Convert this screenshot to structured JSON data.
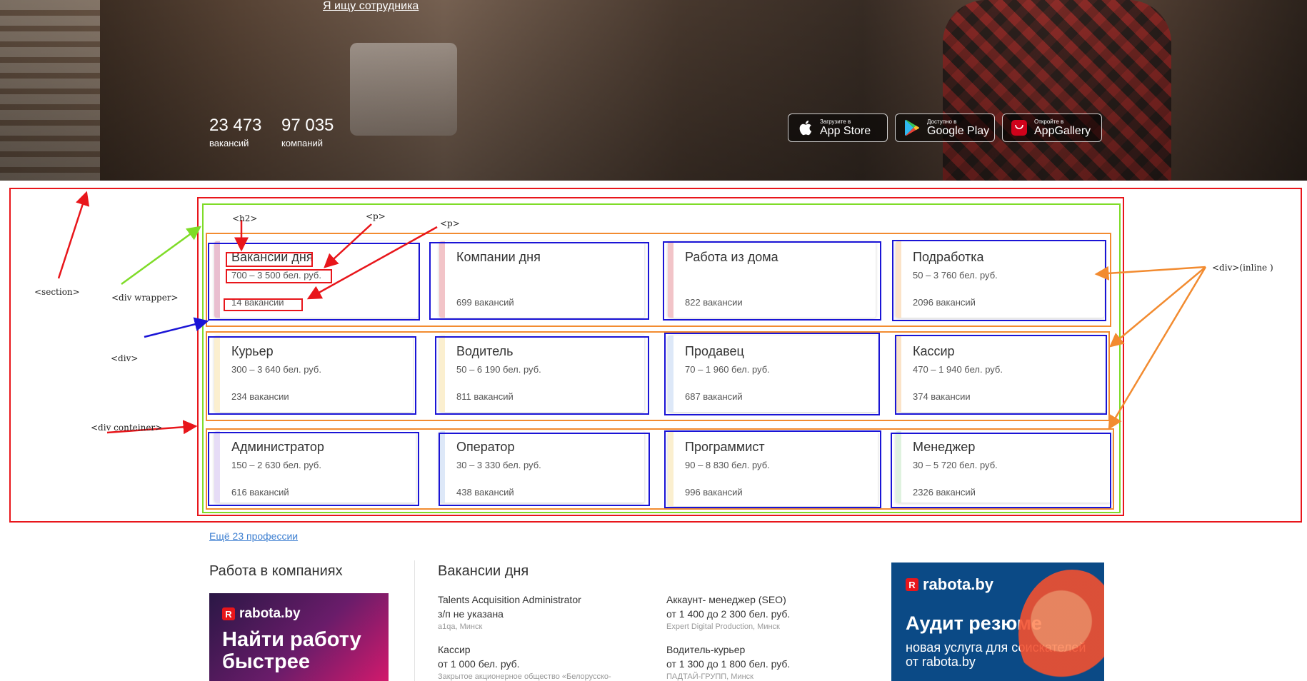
{
  "hero": {
    "employer_link": "Я ищу сотрудника",
    "stats": [
      {
        "value": "23 473",
        "label": "вакансий"
      },
      {
        "value": "97 035",
        "label": "компаний"
      }
    ],
    "stores": [
      {
        "small": "Загрузите в",
        "big": "App Store",
        "icon": "apple-icon"
      },
      {
        "small": "Доступно в",
        "big": "Google Play",
        "icon": "google-play-icon"
      },
      {
        "small": "Откройте в",
        "big": "AppGallery",
        "icon": "huawei-appgallery-icon"
      }
    ]
  },
  "annotations": {
    "section": "<section>",
    "wrapper": "<div wrapper>",
    "div": "<div>",
    "container": "<div conteiner>",
    "h2": "<h2>",
    "p1": "<p>",
    "p2": "<p>",
    "inline": "<div>(inline )",
    "colors": {
      "section": "#e8161b",
      "wrapper": "#7fdc28",
      "row": "#f28b30",
      "card": "#1a14d6"
    }
  },
  "cards": [
    {
      "title": "Вакансии дня",
      "salary": "700 – 3 500 бел. руб.",
      "count": "14 вакансий",
      "stripe": "#e9bfd0"
    },
    {
      "title": "Компании дня",
      "salary": "",
      "count": "699 вакансий",
      "stripe": "#f2c4c8"
    },
    {
      "title": "Работа из дома",
      "salary": "",
      "count": "822 вакансии",
      "stripe": "#f2c4c8"
    },
    {
      "title": "Подработка",
      "salary": "50 – 3 760 бел. руб.",
      "count": "2096 вакансий",
      "stripe": "#fbe3c8"
    },
    {
      "title": "Курьер",
      "salary": "300 – 3 640 бел. руб.",
      "count": "234 вакансии",
      "stripe": "#fbefcf"
    },
    {
      "title": "Водитель",
      "salary": "50 – 6 190 бел. руб.",
      "count": "811 вакансий",
      "stripe": "#fbefcf"
    },
    {
      "title": "Продавец",
      "salary": "70 – 1 960 бел. руб.",
      "count": "687 вакансий",
      "stripe": "#dde8f8"
    },
    {
      "title": "Кассир",
      "salary": "470 – 1 940 бел. руб.",
      "count": "374 вакансии",
      "stripe": "#fbe3c8"
    },
    {
      "title": "Администратор",
      "salary": "150 – 2 630 бел. руб.",
      "count": "616 вакансий",
      "stripe": "#e6dcf6"
    },
    {
      "title": "Оператор",
      "salary": "30 – 3 330 бел. руб.",
      "count": "438 вакансий",
      "stripe": "#dde8f8"
    },
    {
      "title": "Программист",
      "salary": "90 – 8 830 бел. руб.",
      "count": "996 вакансий",
      "stripe": "#fbefcf"
    },
    {
      "title": "Менеджер",
      "salary": "30 – 5 720 бел. руб.",
      "count": "2326 вакансий",
      "stripe": "#dff2df"
    }
  ],
  "more_link": "Ещё 23 профессии",
  "companies": {
    "title": "Работа в компаниях",
    "banner": {
      "logo": "rabota.by",
      "headline": "Найти работу быстрее"
    }
  },
  "vacancies_of_day": {
    "title": "Вакансии дня",
    "items": [
      {
        "title": "Talents Acquisition Administrator",
        "salary": "з/п не указана",
        "company": "a1qa, Минск"
      },
      {
        "title": "Аккаунт- менеджер (SEO)",
        "salary": "от 1 400 до 2 300 бел. руб.",
        "company": "Expert Digital Production, Минск"
      },
      {
        "title": "Кассир",
        "salary": "от 1 000 бел. руб.",
        "company": "Закрытое акционерное общество «Белорусско-"
      },
      {
        "title": "Водитель-курьер",
        "salary": "от 1 300 до 1 800 бел. руб.",
        "company": "ПАДТАЙ-ГРУПП, Минск"
      }
    ]
  },
  "audit_banner": {
    "logo": "rabota.by",
    "headline": "Аудит резюме",
    "subline": "новая услуга для соискателей от rabota.by"
  }
}
